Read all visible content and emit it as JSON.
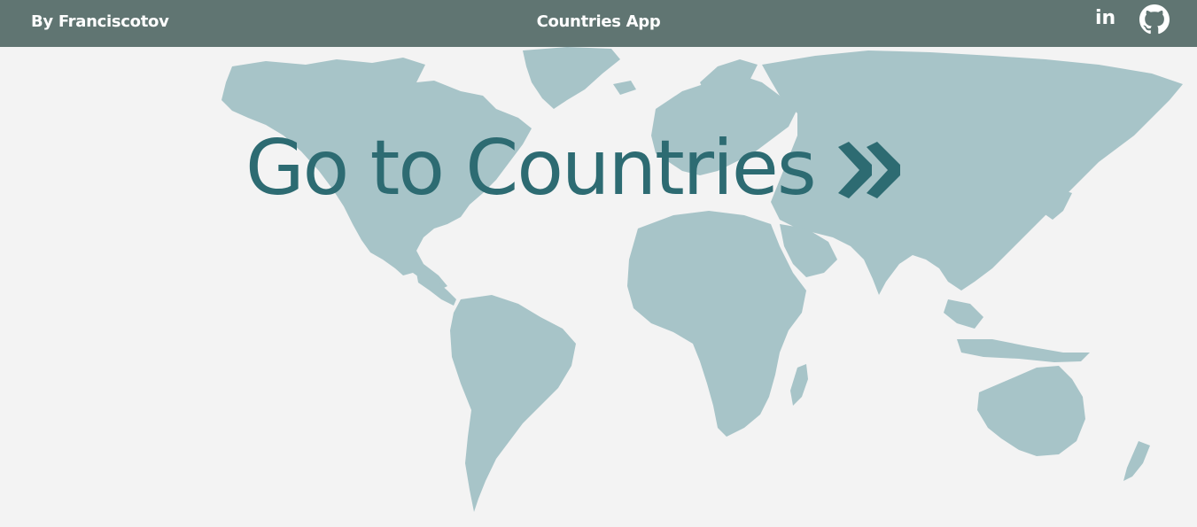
{
  "navbar": {
    "brand": "By Franciscotov",
    "title": "Countries App",
    "linkedin_label": "in",
    "github_icon": "github-icon"
  },
  "hero": {
    "cta_label": "Go to Countries",
    "cta_icon": "double-chevron-right-icon"
  },
  "colors": {
    "navbar_bg": "#607572",
    "page_bg": "#f3f3f3",
    "map_fill": "#a7c4c8",
    "accent": "#2d6b72"
  }
}
